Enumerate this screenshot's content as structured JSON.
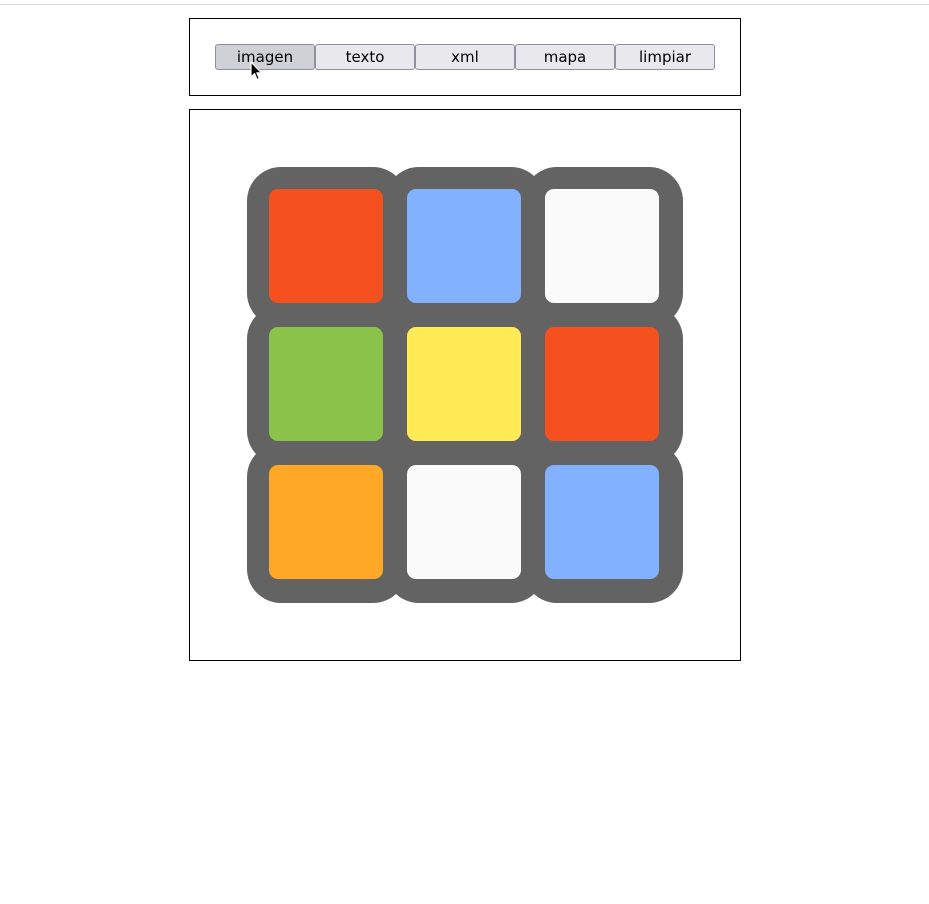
{
  "toolbar": {
    "buttons": [
      {
        "id": "imagen",
        "label": "imagen",
        "active": true
      },
      {
        "id": "texto",
        "label": "texto",
        "active": false
      },
      {
        "id": "xml",
        "label": "xml",
        "active": false
      },
      {
        "id": "mapa",
        "label": "mapa",
        "active": false
      },
      {
        "id": "limpiar",
        "label": "limpiar",
        "active": false
      }
    ]
  },
  "cube_face": {
    "frame_color": "#636363",
    "stickers": [
      [
        "#f4511e",
        "#82b1ff",
        "#fafafa"
      ],
      [
        "#8bc34a",
        "#ffeb56",
        "#f4511e"
      ],
      [
        "#ffa726",
        "#fafafa",
        "#82b1ff"
      ]
    ]
  }
}
